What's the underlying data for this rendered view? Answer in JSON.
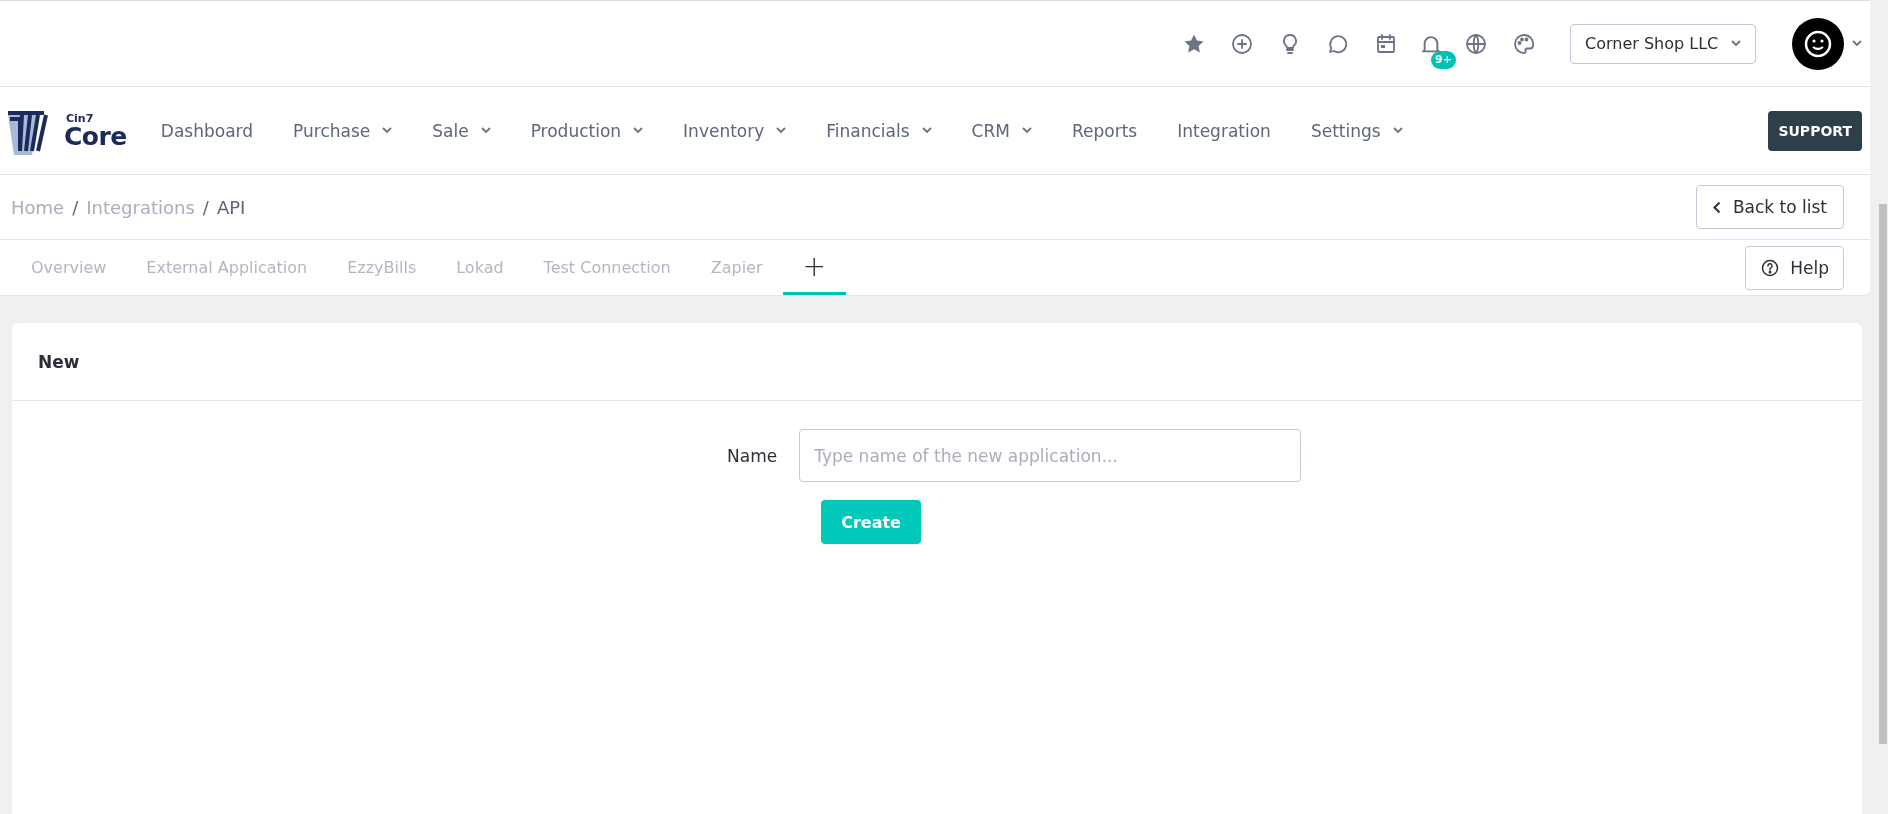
{
  "top_bar": {
    "notification_badge": "9+",
    "company_select": {
      "value": "Corner Shop LLC"
    }
  },
  "logo": {
    "small": "Cin7",
    "large": "Core"
  },
  "nav": [
    {
      "label": "Dashboard",
      "has_menu": false
    },
    {
      "label": "Purchase",
      "has_menu": true
    },
    {
      "label": "Sale",
      "has_menu": true
    },
    {
      "label": "Production",
      "has_menu": true
    },
    {
      "label": "Inventory",
      "has_menu": true
    },
    {
      "label": "Financials",
      "has_menu": true
    },
    {
      "label": "CRM",
      "has_menu": true
    },
    {
      "label": "Reports",
      "has_menu": false
    },
    {
      "label": "Integration",
      "has_menu": false
    },
    {
      "label": "Settings",
      "has_menu": true
    }
  ],
  "support_button": "SUPPORT",
  "breadcrumb": [
    {
      "label": "Home",
      "current": false
    },
    {
      "separator": "/",
      "label": "Integrations",
      "current": false
    },
    {
      "separator": "/",
      "label": "API",
      "current": true
    }
  ],
  "back_button": "Back to list",
  "tabs": [
    {
      "label": "Overview",
      "kind": "text",
      "selected": false
    },
    {
      "label": "External Application",
      "kind": "text",
      "selected": false
    },
    {
      "label": "EzzyBills",
      "kind": "text",
      "selected": false
    },
    {
      "label": "Lokad",
      "kind": "text",
      "selected": false
    },
    {
      "label": "Test Connection",
      "kind": "text",
      "selected": false
    },
    {
      "label": "Zapier",
      "kind": "text",
      "selected": false
    },
    {
      "label": "+",
      "kind": "add",
      "selected": true
    }
  ],
  "help_button": "Help",
  "card": {
    "title": "New",
    "field_label": "Name",
    "placeholder": "Type name of the new application...",
    "create_button": "Create"
  }
}
